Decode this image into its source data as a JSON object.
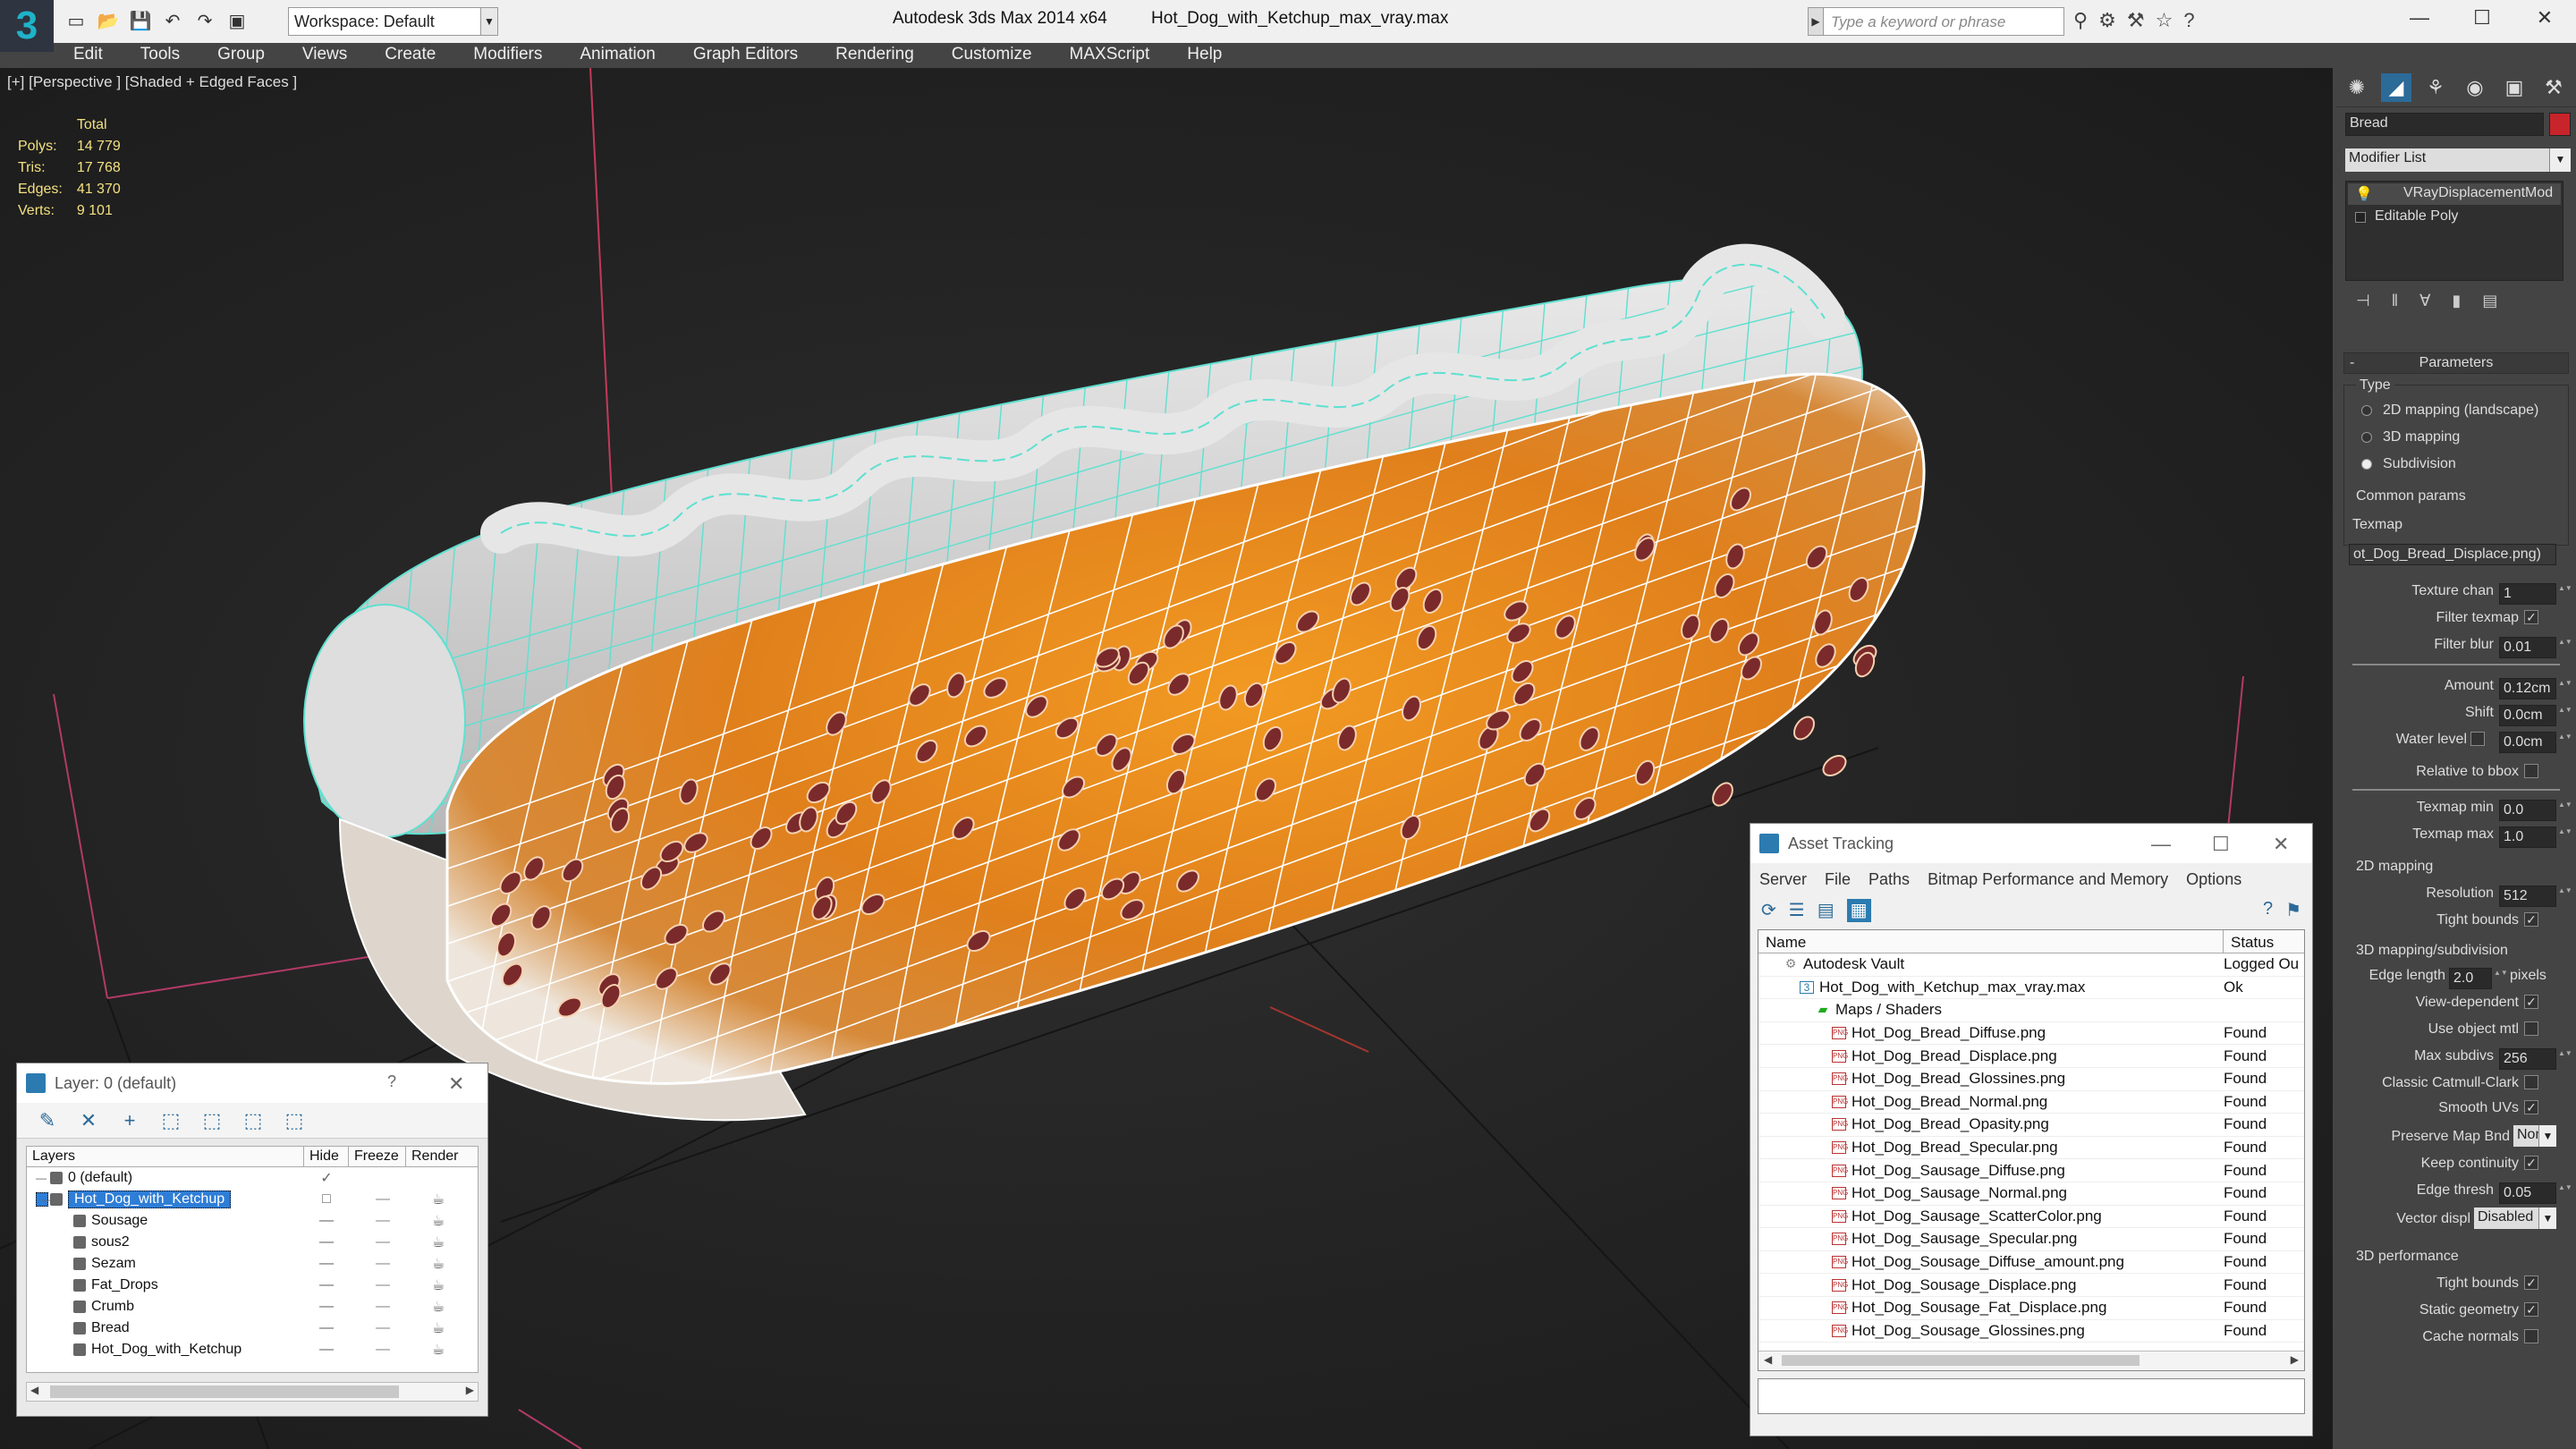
{
  "titlebar": {
    "workspace_label": "Workspace: Default",
    "product": "Autodesk 3ds Max  2014 x64",
    "filename": "Hot_Dog_with_Ketchup_max_vray.max",
    "search_placeholder": "Type a keyword or phrase"
  },
  "menubar": [
    "Edit",
    "Tools",
    "Group",
    "Views",
    "Create",
    "Modifiers",
    "Animation",
    "Graph Editors",
    "Rendering",
    "Customize",
    "MAXScript",
    "Help"
  ],
  "viewport": {
    "label": "[+] [Perspective ] [Shaded + Edged Faces ]",
    "stats_header": "Total",
    "stats": [
      {
        "label": "Polys:",
        "value": "14 779"
      },
      {
        "label": "Tris:",
        "value": "17 768"
      },
      {
        "label": "Edges:",
        "value": "41 370"
      },
      {
        "label": "Verts:",
        "value": "9 101"
      }
    ]
  },
  "layer_window": {
    "title": "Layer: 0 (default)",
    "help": "?",
    "columns": [
      "Layers",
      "Hide",
      "Freeze",
      "Render"
    ],
    "rows": [
      {
        "name": "0 (default)",
        "level": 0,
        "selected": false,
        "hide": "✓",
        "freeze": "",
        "render": ""
      },
      {
        "name": "Hot_Dog_with_Ketchup",
        "level": 0,
        "selected": true,
        "hide": "□",
        "freeze": "—",
        "render": "☕"
      },
      {
        "name": "Sousage",
        "level": 1,
        "selected": false,
        "hide": "—",
        "freeze": "—",
        "render": "☕"
      },
      {
        "name": "sous2",
        "level": 1,
        "selected": false,
        "hide": "—",
        "freeze": "—",
        "render": "☕"
      },
      {
        "name": "Sezam",
        "level": 1,
        "selected": false,
        "hide": "—",
        "freeze": "—",
        "render": "☕"
      },
      {
        "name": "Fat_Drops",
        "level": 1,
        "selected": false,
        "hide": "—",
        "freeze": "—",
        "render": "☕"
      },
      {
        "name": "Crumb",
        "level": 1,
        "selected": false,
        "hide": "—",
        "freeze": "—",
        "render": "☕"
      },
      {
        "name": "Bread",
        "level": 1,
        "selected": false,
        "hide": "—",
        "freeze": "—",
        "render": "☕"
      },
      {
        "name": "Hot_Dog_with_Ketchup",
        "level": 1,
        "selected": false,
        "hide": "—",
        "freeze": "—",
        "render": "☕"
      }
    ]
  },
  "asset_window": {
    "title": "Asset Tracking",
    "menu": [
      "Server",
      "File",
      "Paths",
      "Bitmap Performance and Memory",
      "Options"
    ],
    "columns": [
      "Name",
      "Status"
    ],
    "rows": [
      {
        "name": "Autodesk Vault",
        "indent": 1,
        "status": "Logged Ou"
      },
      {
        "name": "Hot_Dog_with_Ketchup_max_vray.max",
        "indent": 2,
        "status": "Ok"
      },
      {
        "name": "Maps / Shaders",
        "indent": 3,
        "status": ""
      },
      {
        "name": "Hot_Dog_Bread_Diffuse.png",
        "indent": 4,
        "status": "Found"
      },
      {
        "name": "Hot_Dog_Bread_Displace.png",
        "indent": 4,
        "status": "Found"
      },
      {
        "name": "Hot_Dog_Bread_Glossines.png",
        "indent": 4,
        "status": "Found"
      },
      {
        "name": "Hot_Dog_Bread_Normal.png",
        "indent": 4,
        "status": "Found"
      },
      {
        "name": "Hot_Dog_Bread_Opasity.png",
        "indent": 4,
        "status": "Found"
      },
      {
        "name": "Hot_Dog_Bread_Specular.png",
        "indent": 4,
        "status": "Found"
      },
      {
        "name": "Hot_Dog_Sausage_Diffuse.png",
        "indent": 4,
        "status": "Found"
      },
      {
        "name": "Hot_Dog_Sausage_Normal.png",
        "indent": 4,
        "status": "Found"
      },
      {
        "name": "Hot_Dog_Sausage_ScatterColor.png",
        "indent": 4,
        "status": "Found"
      },
      {
        "name": "Hot_Dog_Sausage_Specular.png",
        "indent": 4,
        "status": "Found"
      },
      {
        "name": "Hot_Dog_Sousage_Diffuse_amount.png",
        "indent": 4,
        "status": "Found"
      },
      {
        "name": "Hot_Dog_Sousage_Displace.png",
        "indent": 4,
        "status": "Found"
      },
      {
        "name": "Hot_Dog_Sousage_Fat_Displace.png",
        "indent": 4,
        "status": "Found"
      },
      {
        "name": "Hot_Dog_Sousage_Glossines.png",
        "indent": 4,
        "status": "Found"
      }
    ]
  },
  "command_panel": {
    "object_name": "Bread",
    "object_color": "#c8242b",
    "modifier_list": "Modifier List",
    "stack": [
      "VRayDisplacementMod",
      "Editable Poly"
    ],
    "rollout_title": "Parameters",
    "type_label": "Type",
    "type_options": [
      "2D mapping (landscape)",
      "3D mapping",
      "Subdivision"
    ],
    "type_selected": 2,
    "common_label": "Common params",
    "texmap_label": "Texmap",
    "texmap_value": "ot_Dog_Bread_Displace.png)",
    "texture_chan_label": "Texture chan",
    "texture_chan_value": "1",
    "filter_texmap_label": "Filter texmap",
    "filter_blur_label": "Filter blur",
    "filter_blur_value": "0.01",
    "amount_label": "Amount",
    "amount_value": "0.12cm",
    "shift_label": "Shift",
    "shift_value": "0.0cm",
    "water_label": "Water level",
    "water_value": "0.0cm",
    "relative_label": "Relative to bbox",
    "texmin_label": "Texmap min",
    "texmin_value": "0.0",
    "texmax_label": "Texmap max",
    "texmax_value": "1.0",
    "map2d_label": "2D mapping",
    "resolution_label": "Resolution",
    "resolution_value": "512",
    "tight_label": "Tight bounds",
    "map3d_label": "3D mapping/subdivision",
    "edge_len_label": "Edge length",
    "edge_len_value": "2.0",
    "pixels_label": "pixels",
    "view_dep_label": "View-dependent",
    "use_mtl_label": "Use object mtl",
    "max_sub_label": "Max subdivs",
    "max_sub_value": "256",
    "catmull_label": "Classic Catmull-Clark",
    "smooth_uv_label": "Smooth UVs",
    "preserve_label": "Preserve Map Bnd",
    "preserve_value": "None",
    "keep_label": "Keep continuity",
    "edge_thresh_label": "Edge thresh",
    "edge_thresh_value": "0.05",
    "vector_label": "Vector displ",
    "vector_value": "Disabled",
    "perf_label": "3D performance",
    "perf_tight_label": "Tight bounds",
    "static_label": "Static geometry",
    "cache_label": "Cache normals"
  },
  "colors": {
    "bun": "#e8902a",
    "mustard_wire": "#5ee0d0",
    "bun_wire": "#ffffff",
    "seed": "#7a2a2a",
    "selection": "#2e7dd6",
    "stats_text": "#f3e080"
  }
}
